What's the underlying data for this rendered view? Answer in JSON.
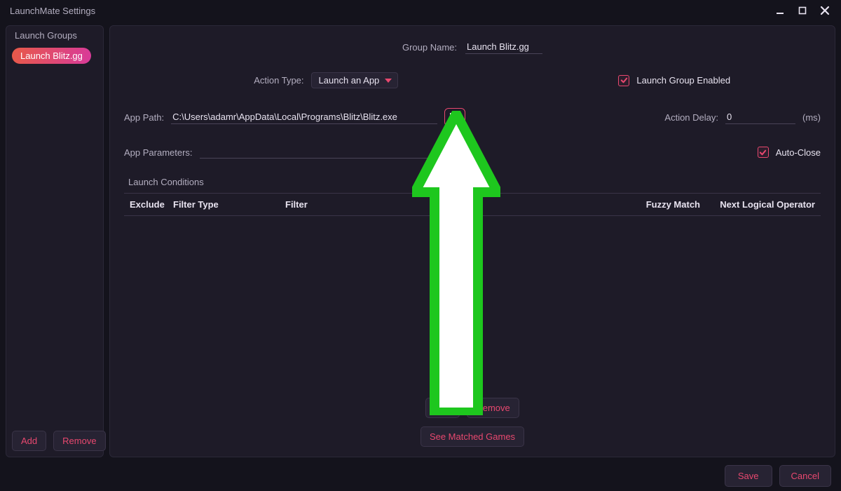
{
  "window": {
    "title": "LaunchMate Settings"
  },
  "sidebar": {
    "title": "Launch Groups",
    "items": [
      "Launch Blitz.gg"
    ],
    "add_label": "Add",
    "remove_label": "Remove"
  },
  "main": {
    "group_name_label": "Group Name:",
    "group_name_value": "Launch Blitz.gg",
    "action_type_label": "Action Type:",
    "action_type_value": "Launch an App",
    "enabled_label": "Launch Group Enabled",
    "enabled_checked": true,
    "app_path_label": "App Path:",
    "app_path_value": "C:\\Users\\adamr\\AppData\\Local\\Programs\\Blitz\\Blitz.exe",
    "action_delay_label": "Action Delay:",
    "action_delay_value": "0",
    "action_delay_unit": "(ms)",
    "app_params_label": "App Parameters:",
    "app_params_value": "",
    "autoclose_label": "Auto-Close",
    "autoclose_checked": true,
    "conditions_title": "Launch Conditions",
    "columns": {
      "exclude": "Exclude",
      "filter_type": "Filter Type",
      "filter": "Filter",
      "fuzzy": "Fuzzy Match",
      "next_op": "Next Logical Operator"
    },
    "cond_add_label": "Add",
    "cond_remove_label": "Remove",
    "see_matched_label": "See Matched Games"
  },
  "footer": {
    "save_label": "Save",
    "cancel_label": "Cancel"
  }
}
